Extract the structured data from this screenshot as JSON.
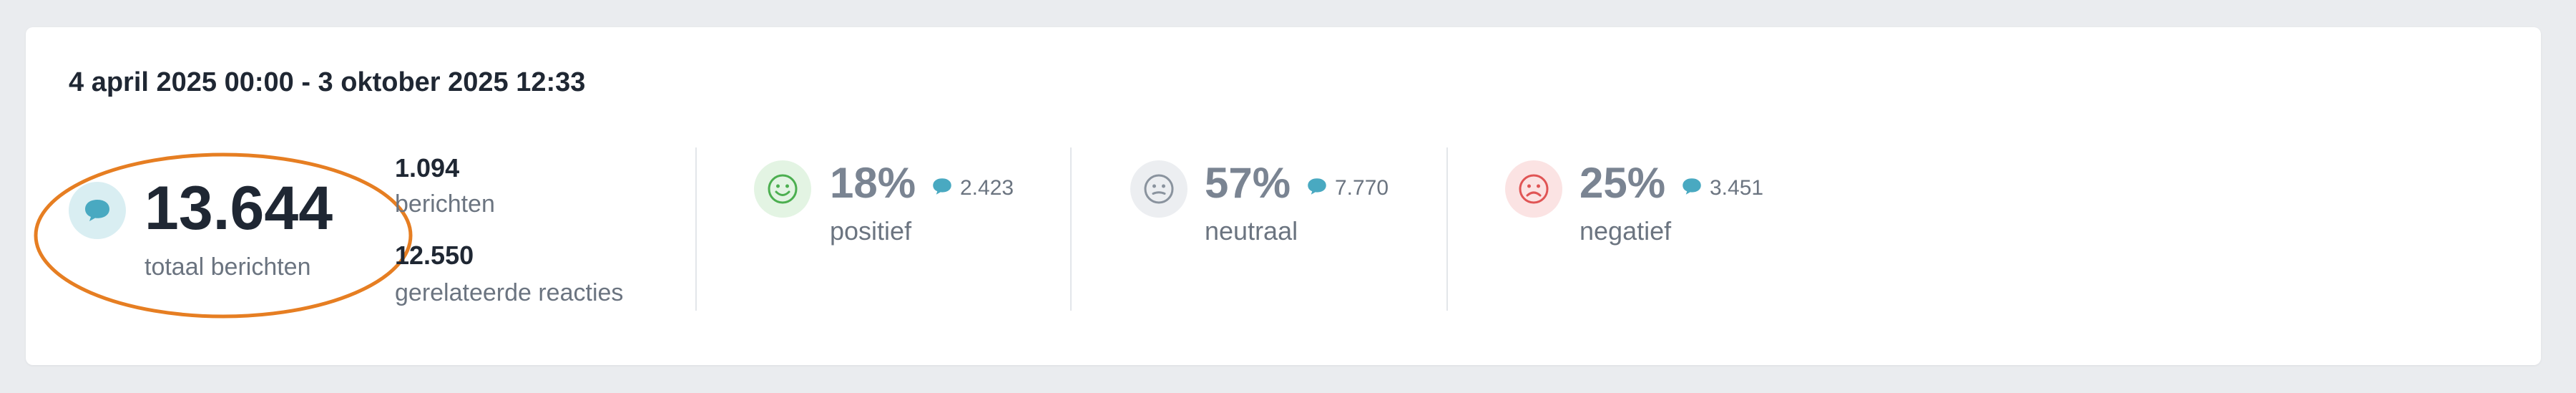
{
  "date_range": "4 april 2025 00:00 - 3 oktober 2025 12:33",
  "total": {
    "value": "13.644",
    "label": "totaal berichten",
    "icon": "speech-bubble-icon"
  },
  "breakdown": [
    {
      "value": "1.094",
      "label": "berichten"
    },
    {
      "value": "12.550",
      "label": "gerelateerde reacties"
    }
  ],
  "sentiments": [
    {
      "key": "positive",
      "percent": "18%",
      "count": "2.423",
      "label": "positief",
      "icon": "smiley-happy-icon",
      "icon_bg": "#e3f4e3",
      "icon_color": "#4caf50"
    },
    {
      "key": "neutral",
      "percent": "57%",
      "count": "7.770",
      "label": "neutraal",
      "icon": "smiley-neutral-icon",
      "icon_bg": "#eceef1",
      "icon_color": "#8a939e"
    },
    {
      "key": "negative",
      "percent": "25%",
      "count": "3.451",
      "label": "negatief",
      "icon": "smiley-sad-icon",
      "icon_bg": "#fbe3e3",
      "icon_color": "#e05555"
    }
  ],
  "colors": {
    "accent": "#49a9c1",
    "highlight": "#e67e22",
    "text_dark": "#1f2733",
    "text_muted": "#6b7480"
  }
}
